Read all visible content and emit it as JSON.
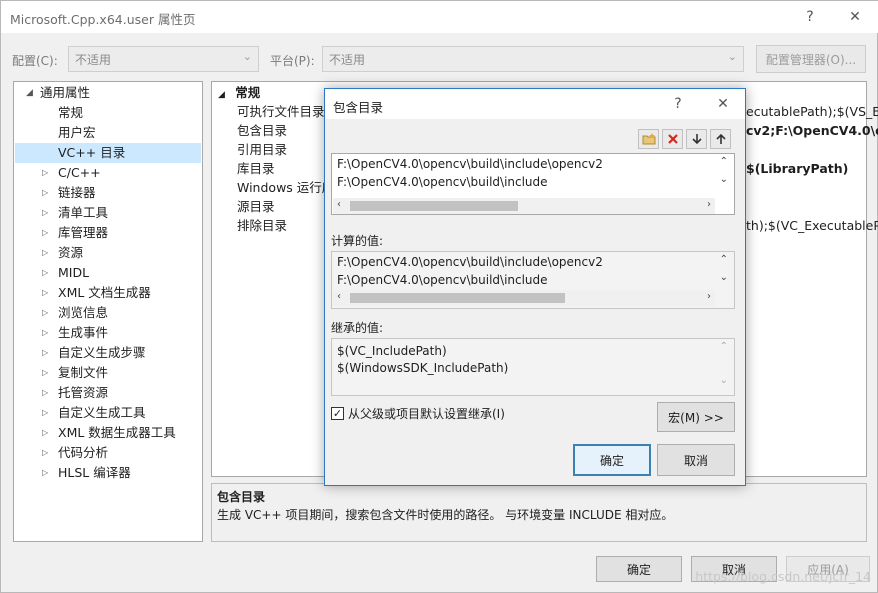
{
  "window": {
    "title": "Microsoft.Cpp.x64.user 属性页",
    "help_glyph": "?",
    "close_glyph": "✕"
  },
  "toolbar": {
    "config_label": "配置(C):",
    "config_value": "不适用",
    "platform_label": "平台(P):",
    "platform_value": "不适用",
    "config_manager_label": "配置管理器(O)..."
  },
  "tree": {
    "root_label": "通用属性",
    "items": [
      {
        "label": "常规",
        "expandable": false
      },
      {
        "label": "用户宏",
        "expandable": false
      },
      {
        "label": "VC++ 目录",
        "expandable": false,
        "selected": true
      },
      {
        "label": "C/C++",
        "expandable": true
      },
      {
        "label": "链接器",
        "expandable": true
      },
      {
        "label": "清单工具",
        "expandable": true
      },
      {
        "label": "库管理器",
        "expandable": true
      },
      {
        "label": "资源",
        "expandable": true
      },
      {
        "label": "MIDL",
        "expandable": true
      },
      {
        "label": "XML 文档生成器",
        "expandable": true
      },
      {
        "label": "浏览信息",
        "expandable": true
      },
      {
        "label": "生成事件",
        "expandable": true
      },
      {
        "label": "自定义生成步骤",
        "expandable": true
      },
      {
        "label": "复制文件",
        "expandable": true
      },
      {
        "label": "托管资源",
        "expandable": true
      },
      {
        "label": "自定义生成工具",
        "expandable": true
      },
      {
        "label": "XML 数据生成器工具",
        "expandable": true
      },
      {
        "label": "代码分析",
        "expandable": true
      },
      {
        "label": "HLSL 编译器",
        "expandable": true
      }
    ]
  },
  "grid": {
    "section_label": "常规",
    "rows": [
      {
        "name": "可执行文件目录",
        "value": "ecutablePath);$(VS_E",
        "bold": false
      },
      {
        "name": "包含目录",
        "value": "cv2;F:\\OpenCV4.0\\o",
        "bold": true
      },
      {
        "name": "引用目录",
        "value": "",
        "bold": false
      },
      {
        "name": "库目录",
        "value": "$(LibraryPath)",
        "bold": true
      },
      {
        "name": "Windows 运行库",
        "value": "",
        "bold": false
      },
      {
        "name": "源目录",
        "value": "",
        "bold": false
      },
      {
        "name": "排除目录",
        "value": "th);$(VC_ExecutablePa",
        "bold": false
      }
    ]
  },
  "description": {
    "title": "包含目录",
    "text": "生成 VC++ 项目期间，搜索包含文件时使用的路径。  与环境变量 INCLUDE 相对应。"
  },
  "footer": {
    "ok_label": "确定",
    "cancel_label": "取消",
    "apply_label": "应用(A)"
  },
  "dialog": {
    "title": "包含目录",
    "help_glyph": "?",
    "close_glyph": "✕",
    "toolbar_icons": [
      "new-folder-icon",
      "delete-icon",
      "move-down-icon",
      "move-up-icon"
    ],
    "edit_lines": [
      "F:\\OpenCV4.0\\opencv\\build\\include\\opencv2",
      "F:\\OpenCV4.0\\opencv\\build\\include"
    ],
    "evaluated_label": "计算的值:",
    "evaluated_lines": [
      "F:\\OpenCV4.0\\opencv\\build\\include\\opencv2",
      "F:\\OpenCV4.0\\opencv\\build\\include"
    ],
    "inherited_label": "继承的值:",
    "inherited_lines": [
      "$(VC_IncludePath)",
      "$(WindowsSDK_IncludePath)"
    ],
    "inherit_checkbox_label": "从父级或项目默认设置继承(I)",
    "inherit_checked": true,
    "macros_label": "宏(M) >>",
    "ok_label": "确定",
    "cancel_label": "取消"
  },
  "watermark": "https://blog.csdn.net/jcfr_14"
}
